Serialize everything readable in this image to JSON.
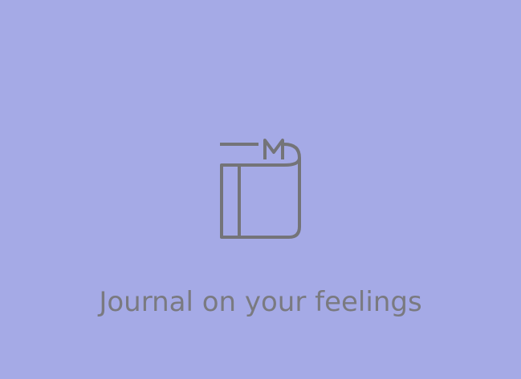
{
  "tile": {
    "background_color": "#a5aae6",
    "icon": "journal-book-icon",
    "icon_color": "#747478",
    "caption": "Journal on your feelings",
    "caption_color": "#7a7a80"
  }
}
